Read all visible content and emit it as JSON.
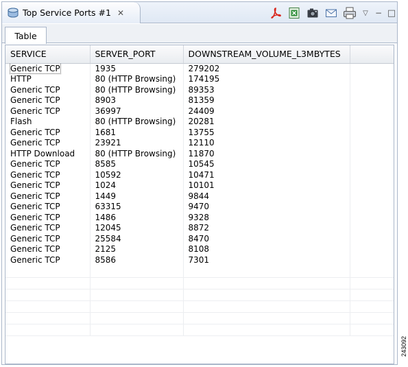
{
  "view": {
    "title": "Top Service Ports #1",
    "close_glyph": "✕",
    "icon": "database-icon"
  },
  "toolbar": {
    "buttons": [
      "pdf-export-icon",
      "excel-export-icon",
      "camera-icon",
      "email-icon",
      "print-icon"
    ],
    "view_menu_glyph": "▽",
    "minimize_glyph": "−",
    "maximize_glyph": "□"
  },
  "tabs": [
    {
      "label": "Table",
      "active": true
    }
  ],
  "table": {
    "columns": [
      "SERVICE",
      "SERVER_PORT",
      "DOWNSTREAM_VOLUME_L3MBYTES",
      ""
    ],
    "rows": [
      [
        "Generic TCP",
        "1935",
        "279202"
      ],
      [
        "HTTP",
        "80 (HTTP Browsing)",
        "174195"
      ],
      [
        "Generic TCP",
        "80 (HTTP Browsing)",
        "89353"
      ],
      [
        "Generic TCP",
        "8903",
        "81359"
      ],
      [
        "Generic TCP",
        "36997",
        "24409"
      ],
      [
        "Flash",
        "80 (HTTP Browsing)",
        "20281"
      ],
      [
        "Generic TCP",
        "1681",
        "13755"
      ],
      [
        "Generic TCP",
        "23921",
        "12110"
      ],
      [
        "HTTP Download",
        "80 (HTTP Browsing)",
        "11870"
      ],
      [
        "Generic TCP",
        "8585",
        "10545"
      ],
      [
        "Generic TCP",
        "10592",
        "10471"
      ],
      [
        "Generic TCP",
        "1024",
        "10101"
      ],
      [
        "Generic TCP",
        "1449",
        "9844"
      ],
      [
        "Generic TCP",
        "63315",
        "9470"
      ],
      [
        "Generic TCP",
        "1486",
        "9328"
      ],
      [
        "Generic TCP",
        "12045",
        "8872"
      ],
      [
        "Generic TCP",
        "25584",
        "8470"
      ],
      [
        "Generic TCP",
        "2125",
        "8108"
      ],
      [
        "Generic TCP",
        "8586",
        "7301"
      ]
    ],
    "empty_rows": 6
  },
  "figure_id": "243092",
  "colors": {
    "border": "#a9b6c9",
    "titlebar": "#dfe8f4",
    "pdf_red": "#d9271d",
    "excel_green": "#2f8f3a"
  }
}
